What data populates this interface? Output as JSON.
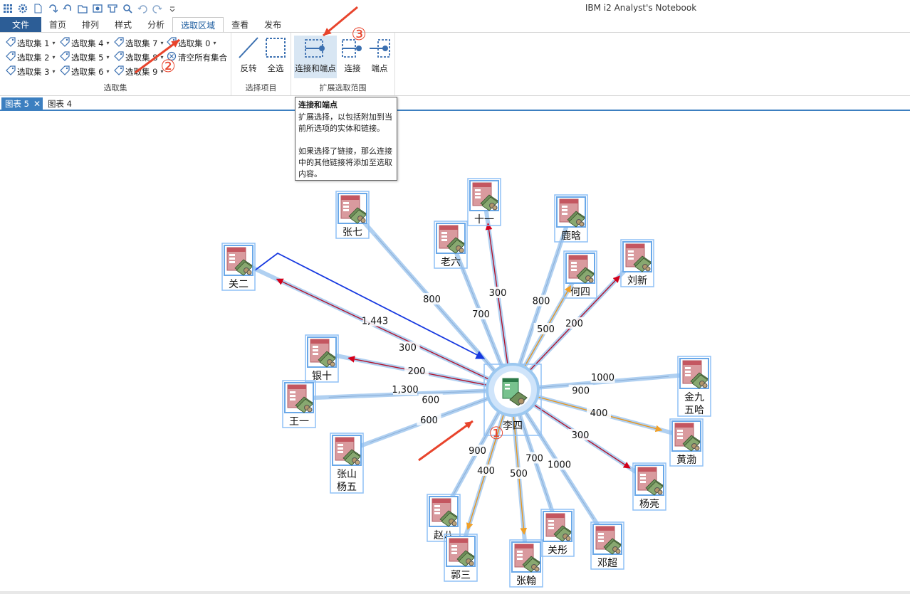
{
  "window": {
    "title": "IBM i2 Analyst's Notebook"
  },
  "quick_access": [
    "grid-icon",
    "gear-icon",
    "new-document-icon",
    "redo-arrow-icon",
    "undo-arrow-icon",
    "folder-icon",
    "snapshot-icon",
    "funnel-icon",
    "search-icon",
    "undo-icon",
    "redo-icon",
    "customize-dropdown-icon"
  ],
  "tabs": [
    {
      "label": "文件",
      "kind": "file"
    },
    {
      "label": "首页"
    },
    {
      "label": "排列"
    },
    {
      "label": "样式"
    },
    {
      "label": "分析"
    },
    {
      "label": "选取区域",
      "active": true
    },
    {
      "label": "查看"
    },
    {
      "label": "发布"
    }
  ],
  "ribbon": {
    "selection_sets": {
      "group_label": "选取集",
      "sets": [
        {
          "label": "选取集 1"
        },
        {
          "label": "选取集 4"
        },
        {
          "label": "选取集 7"
        },
        {
          "label": "选取集 0"
        },
        {
          "label": "选取集 2"
        },
        {
          "label": "选取集 5"
        },
        {
          "label": "选取集 8"
        },
        {
          "label": "选取集 3"
        },
        {
          "label": "选取集 6"
        },
        {
          "label": "选取集 9"
        }
      ],
      "clear_all": "清空所有集合"
    },
    "select_items": {
      "group_label": "选择项目",
      "invert": "反转",
      "select_all": "全选"
    },
    "extend": {
      "group_label": "扩展选取范围",
      "links_and_ends": "连接和端点",
      "links": "连接",
      "ends": "端点"
    }
  },
  "doc_tabs": [
    {
      "label": "图表 5",
      "active": true,
      "close": "✕"
    },
    {
      "label": "图表 4"
    }
  ],
  "tooltip": {
    "title": "连接和端点",
    "p1": "扩展选择，以包括附加到当前所选项的实体和链接。",
    "p2": "如果选择了链接，那么连接中的其他链接将添加至选取内容。"
  },
  "annotations": {
    "marker1": "①",
    "marker2": "②",
    "marker3": "③",
    "color": "#e8442c"
  },
  "chart": {
    "center": {
      "label": "李四"
    },
    "entities": [
      {
        "id": "guan_er",
        "label": [
          "关二"
        ]
      },
      {
        "id": "zhang_qi",
        "label": [
          "张七"
        ]
      },
      {
        "id": "lao_liu",
        "label": [
          "老六"
        ]
      },
      {
        "id": "shi_yi",
        "label": [
          "十一"
        ]
      },
      {
        "id": "lu_han",
        "label": [
          "鹿晗"
        ]
      },
      {
        "id": "he_si",
        "label": [
          "何四"
        ]
      },
      {
        "id": "liu_xin",
        "label": [
          "刘新"
        ]
      },
      {
        "id": "yin_shi",
        "label": [
          "银十"
        ]
      },
      {
        "id": "wang_yi",
        "label": [
          "王一"
        ]
      },
      {
        "id": "zhang_shan",
        "label": [
          "张山",
          "杨五"
        ]
      },
      {
        "id": "jin_jiu",
        "label": [
          "金九",
          "五哈"
        ]
      },
      {
        "id": "huang_bo",
        "label": [
          "黄渤"
        ]
      },
      {
        "id": "yang_liang",
        "label": [
          "杨亮"
        ]
      },
      {
        "id": "zhao_ba",
        "label": [
          "赵八"
        ]
      },
      {
        "id": "guo_san",
        "label": [
          "郭三"
        ]
      },
      {
        "id": "zhang_han",
        "label": [
          "张翰"
        ]
      },
      {
        "id": "guan_tong",
        "label": [
          "关彤"
        ]
      },
      {
        "id": "deng_chao",
        "label": [
          "邓超"
        ]
      }
    ],
    "links": [
      {
        "to": "guan_er",
        "values": [
          "1,443",
          "300"
        ]
      },
      {
        "to": "zhang_qi",
        "values": [
          "800"
        ]
      },
      {
        "to": "lao_liu",
        "values": [
          "700"
        ]
      },
      {
        "to": "shi_yi",
        "values": [
          "300"
        ]
      },
      {
        "to": "lu_han",
        "values": [
          "800"
        ]
      },
      {
        "to": "he_si",
        "values": [
          "500"
        ]
      },
      {
        "to": "liu_xin",
        "values": [
          "200"
        ]
      },
      {
        "to": "yin_shi",
        "values": [
          "200"
        ]
      },
      {
        "to": "wang_yi",
        "values": [
          "1,300",
          "600"
        ]
      },
      {
        "to": "zhang_shan",
        "values": [
          "600"
        ]
      },
      {
        "to": "jin_jiu",
        "values": [
          "1000",
          "900"
        ]
      },
      {
        "to": "huang_bo",
        "values": [
          "400"
        ]
      },
      {
        "to": "yang_liang",
        "values": [
          "300"
        ]
      },
      {
        "to": "zhao_ba",
        "values": [
          "900"
        ]
      },
      {
        "to": "guo_san",
        "values": [
          "400"
        ]
      },
      {
        "to": "zhang_han",
        "values": [
          "500"
        ]
      },
      {
        "to": "guan_tong",
        "values": [
          "700"
        ]
      },
      {
        "to": "deng_chao",
        "values": [
          "1000"
        ]
      }
    ]
  }
}
